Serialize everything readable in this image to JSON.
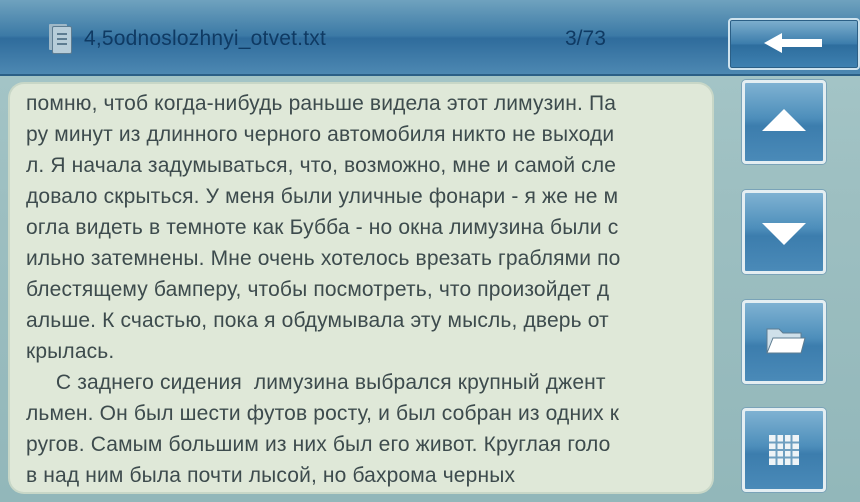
{
  "titlebar": {
    "file_icon": "document-icon",
    "file_name": "4,5odnoslozhnyi_otvet.txt",
    "page_counter": "3/73",
    "back_icon": "arrow-left-icon"
  },
  "reader": {
    "lines": [
      "помню, чтоб когда-нибудь раньше видела этот лимузин. Па",
      "ру минут из длинного черного автомобиля никто не выходи",
      "л. Я начала задумываться, что, возможно, мне и самой сле",
      "довало скрыться. У меня были уличные фонари - я же не м",
      "огла видеть в темноте как Бубба - но окна лимузина были с",
      "ильно затемнены. Мне очень хотелось врезать граблями по",
      " блестящему бамперу, чтобы посмотреть, что произойдет д",
      "альше. К счастью, пока я обдумывала эту мысль, дверь от",
      "крылась.",
      "     С заднего сидения  лимузина выбрался крупный джент",
      "льмен. Он был шести футов росту, и был собран из одних к",
      "ругов. Самым большим из них был его живот. Круглая голо",
      "в над ним была почти лысой, но бахрома черных"
    ]
  },
  "controls": {
    "scroll_up_icon": "triangle-up-icon",
    "scroll_down_icon": "triangle-down-icon",
    "open_folder_icon": "folder-icon",
    "menu_grid_icon": "grid-icon"
  }
}
